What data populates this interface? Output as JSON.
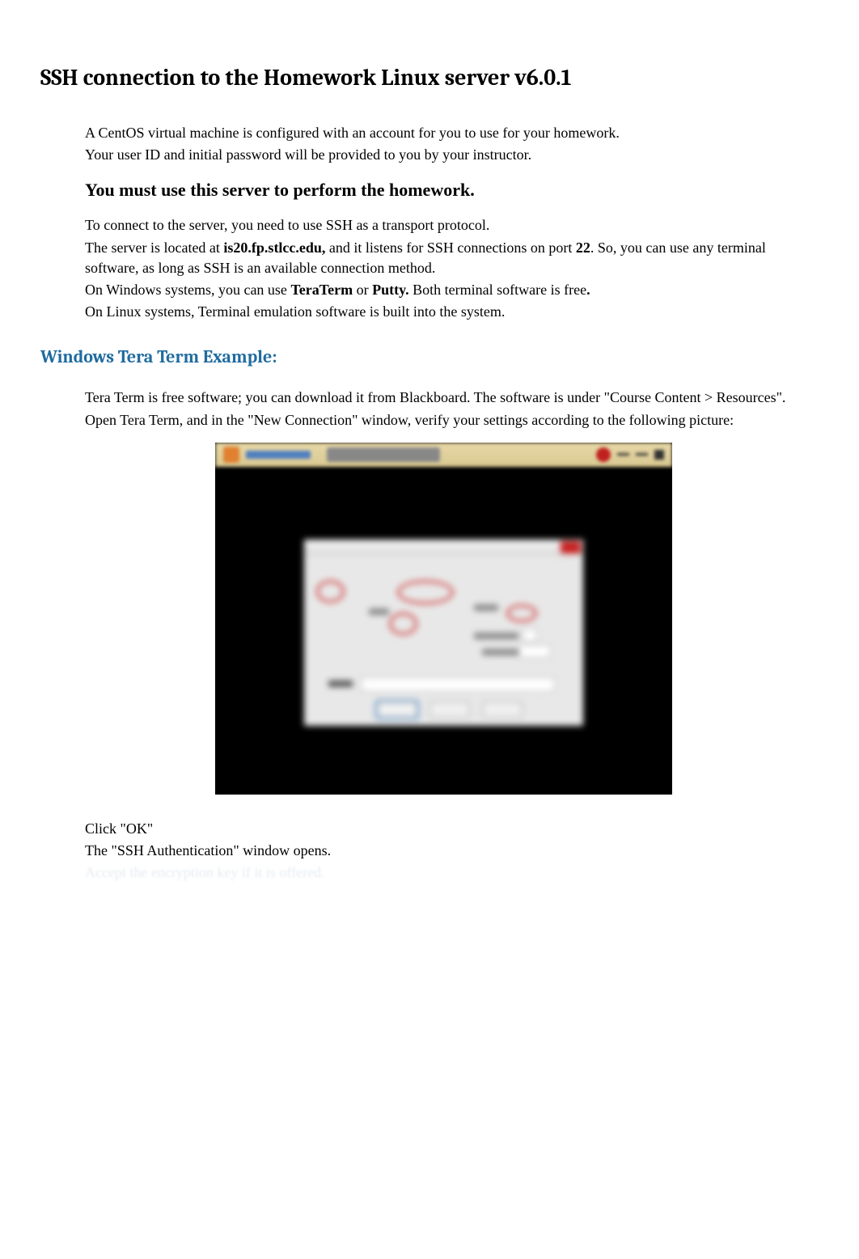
{
  "title": "SSH connection to the Homework Linux server v6.0.1",
  "intro": {
    "line1": "A CentOS virtual machine is configured with an account for you to use for your homework.",
    "line2": "Your user ID and initial password will be provided to you by your instructor."
  },
  "mandate": "You must use this server to perform the homework.",
  "connect": {
    "line1": "To connect to the server, you need to use SSH as a transport protocol.",
    "line2a": "The server is located at ",
    "server": "is20.fp.stlcc.edu,",
    "line2b": " and it listens for SSH connections on port ",
    "port": "22",
    "line2c": ". So, you can use any terminal software, as long as SSH is an available connection method.",
    "line3a": "On Windows systems, you can use ",
    "tool1": "TeraTerm",
    "line3b": " or ",
    "tool2": "Putty.",
    "line3c": " Both terminal software is free",
    "line3d": ".",
    "line4": "On Linux systems, Terminal emulation software is built into the system."
  },
  "section2": {
    "heading": "Windows Tera Term Example:",
    "p1": "Tera Term is free software; you can download it from Blackboard. The software is under \"Course Content  > Resources\".",
    "p2": "Open Tera Term, and in the \"New Connection\" window, verify your settings according to the following picture:"
  },
  "after": {
    "line1": "Click \"OK\"",
    "line2": "The \"SSH Authentication\" window opens.",
    "line3": "Accept the encryption key if it is offered."
  }
}
